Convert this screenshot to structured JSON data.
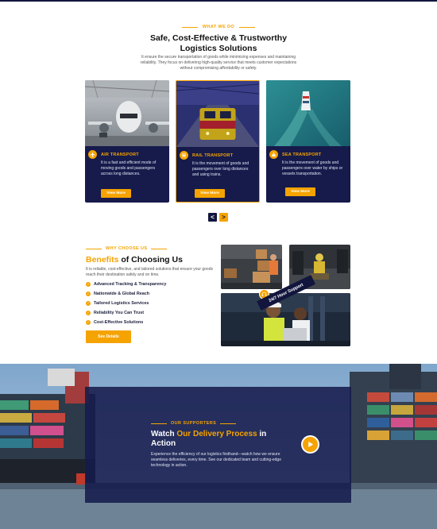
{
  "what_we_do": {
    "eyebrow": "WHAT WE DO",
    "title_line1": "Safe, Cost-Effective & Trustworthy",
    "title_line2": "Logistics Solutions",
    "description": "It ensure the secure transportation of goods while minimizing expenses and maintaining reliability. They focus on delivering high-quality service that meets customer expectations without compromising affordability or safety.",
    "cards": [
      {
        "icon": "airplane-icon",
        "title": "AIR TRANSPORT",
        "text": "It is a fast and efficient mode of moving goods and passengers across long distances.",
        "button": "View More"
      },
      {
        "icon": "train-icon",
        "title": "RAIL TRANSPORT",
        "text": "It is the movement of goods and passengers over long distances and using  trains.",
        "button": "View More"
      },
      {
        "icon": "ship-icon",
        "title": "SEA TRANSPORT",
        "text": "It is the movement of goods and passengers over water by ships or vessels transportation.",
        "button": "View More"
      }
    ],
    "pager": {
      "prev": "<",
      "next": ">"
    }
  },
  "why_choose_us": {
    "eyebrow": "WHY CHOOSE US",
    "title_highlight": "Benefits",
    "title_rest": " of Choosing Us",
    "description": "It is reliable, cost-effective, and tailored solutions that ensure your goods reach their destination safely and on time.",
    "features": [
      "Advanced Tracking & Transparency",
      "Nationwide & Global Reach",
      "Tailored Logistics Services",
      "Reliability You Can Trust",
      "Cost-Effective Solutions"
    ],
    "button": "See Details",
    "ribbon": "24/7 Hour Support"
  },
  "video_section": {
    "eyebrow": "OUR SUPPORTERS",
    "title_prefix": "Watch ",
    "title_highlight": "Our Delivery Process",
    "title_suffix": " in Action",
    "description": "Experience the efficiency of our logistics firsthand—watch how we ensure seamless deliveries, every time. See our dedicated team and cutting-edge technology in action."
  },
  "colors": {
    "accent": "#f5a300",
    "navy": "#161b4c",
    "dark": "#12163d"
  }
}
